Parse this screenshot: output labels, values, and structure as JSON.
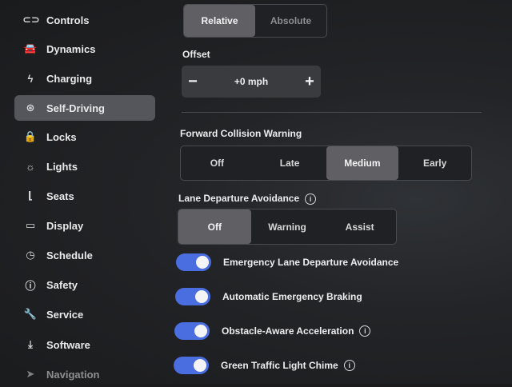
{
  "sidebar": {
    "items": [
      {
        "label": "Controls",
        "icon": "toggle-icon"
      },
      {
        "label": "Dynamics",
        "icon": "car-icon"
      },
      {
        "label": "Charging",
        "icon": "bolt-icon"
      },
      {
        "label": "Self-Driving",
        "icon": "steering-wheel-icon",
        "active": true
      },
      {
        "label": "Locks",
        "icon": "lock-icon"
      },
      {
        "label": "Lights",
        "icon": "light-icon"
      },
      {
        "label": "Seats",
        "icon": "seat-icon"
      },
      {
        "label": "Display",
        "icon": "display-icon"
      },
      {
        "label": "Schedule",
        "icon": "clock-icon"
      },
      {
        "label": "Safety",
        "icon": "alert-icon"
      },
      {
        "label": "Service",
        "icon": "wrench-icon"
      },
      {
        "label": "Software",
        "icon": "download-icon"
      },
      {
        "label": "Navigation",
        "icon": "navigation-icon"
      }
    ]
  },
  "offset_mode": {
    "options": [
      "Relative",
      "Absolute"
    ],
    "selected": "Relative"
  },
  "offset": {
    "label": "Offset",
    "minus": "−",
    "value": "+0 mph",
    "plus": "+"
  },
  "fcw": {
    "label": "Forward Collision Warning",
    "options": [
      "Off",
      "Late",
      "Medium",
      "Early"
    ],
    "selected": "Medium"
  },
  "lda": {
    "label": "Lane Departure Avoidance",
    "options": [
      "Off",
      "Warning",
      "Assist"
    ],
    "selected": "Off"
  },
  "toggles": [
    {
      "label": "Emergency Lane Departure Avoidance",
      "on": true,
      "info": false
    },
    {
      "label": "Automatic Emergency Braking",
      "on": true,
      "info": false
    },
    {
      "label": "Obstacle-Aware Acceleration",
      "on": true,
      "info": true
    },
    {
      "label": "Green Traffic Light Chime",
      "on": true,
      "info": true
    }
  ],
  "colors": {
    "toggle_on": "#4a6ee0",
    "selected_segment": "#5f5f64",
    "active_nav": "#55565b"
  }
}
